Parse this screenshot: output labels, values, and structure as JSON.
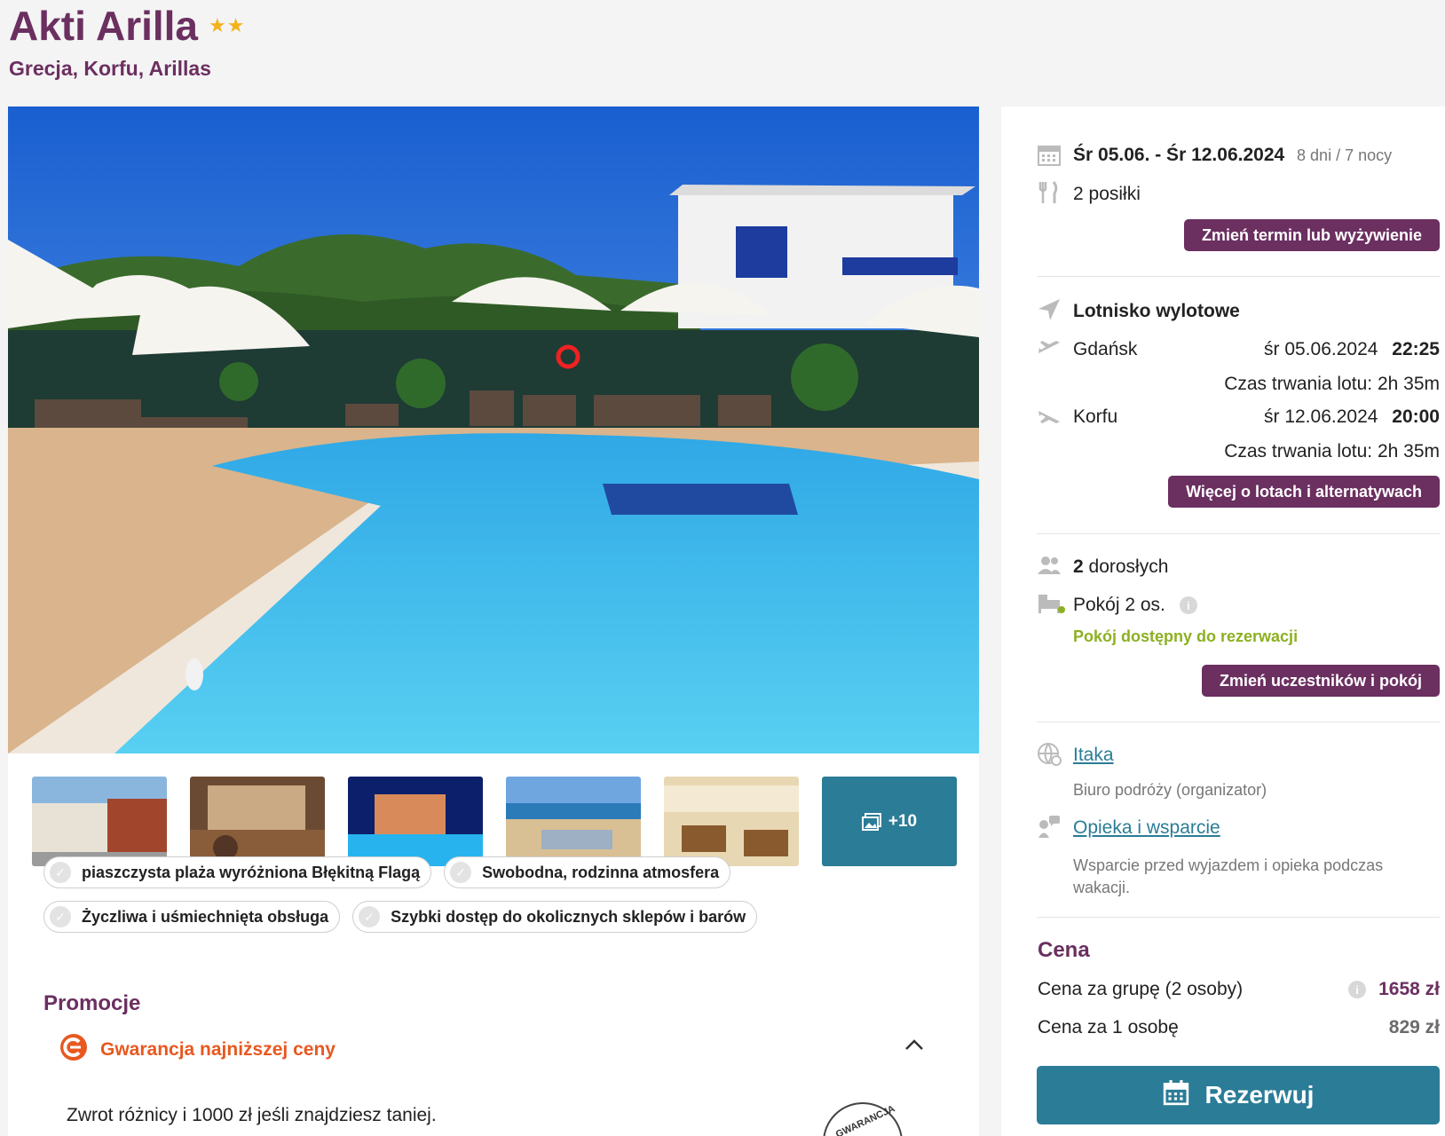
{
  "hotel": {
    "name": "Akti Arilla",
    "stars": "★★",
    "location": "Grecja, Korfu, Arillas"
  },
  "gallery": {
    "more_label": "+10"
  },
  "features": [
    "piaszczysta plaża wyróżniona Błękitną Flagą",
    "Swobodna, rodzinna atmosfera",
    "Życzliwa i uśmiechnięta obsługa",
    "Szybki dostęp do okolicznych sklepów i barów"
  ],
  "promotions": {
    "title": "Promocje",
    "item_label": "Gwarancja najniższej ceny",
    "item_text": "Zwrot różnicy i 1000 zł jeśli znajdziesz taniej.",
    "stamp_text": "GWARANCJA"
  },
  "trip": {
    "dates": "Śr 05.06. - Śr 12.06.2024",
    "duration": "8 dni / 7 nocy",
    "meals": "2 posiłki",
    "change_button": "Zmień termin lub wyżywienie"
  },
  "flights": {
    "airport_label": "Lotnisko wylotowe",
    "outbound": {
      "city": "Gdańsk",
      "date": "śr 05.06.2024",
      "time": "22:25",
      "duration": "Czas trwania lotu: 2h 35m"
    },
    "return": {
      "city": "Korfu",
      "date": "śr 12.06.2024",
      "time": "20:00",
      "duration": "Czas trwania lotu: 2h 35m"
    },
    "more_button": "Więcej o lotach i alternatywach"
  },
  "guests": {
    "adults_count": "2",
    "adults_label": "dorosłych",
    "room": "Pokój 2 os.",
    "availability": "Pokój dostępny do rezerwacji",
    "change_button": "Zmień uczestników i pokój"
  },
  "organizer": {
    "name": "Itaka",
    "subtitle": "Biuro podróży (organizator)",
    "support_link": "Opieka i wsparcie",
    "support_text": "Wsparcie przed wyjazdem i opieka podczas wakacji."
  },
  "price": {
    "title": "Cena",
    "group_label": "Cena za grupę (2 osoby)",
    "group_value": "1658 zł",
    "per_person_label": "Cena za 1 osobę",
    "per_person_value": "829 zł",
    "book_button": "Rezerwuj"
  },
  "colors": {
    "brand_purple": "#6b2f60",
    "accent_teal": "#2b7c97",
    "promo_orange": "#e8581f",
    "available_green": "#8cb021"
  }
}
